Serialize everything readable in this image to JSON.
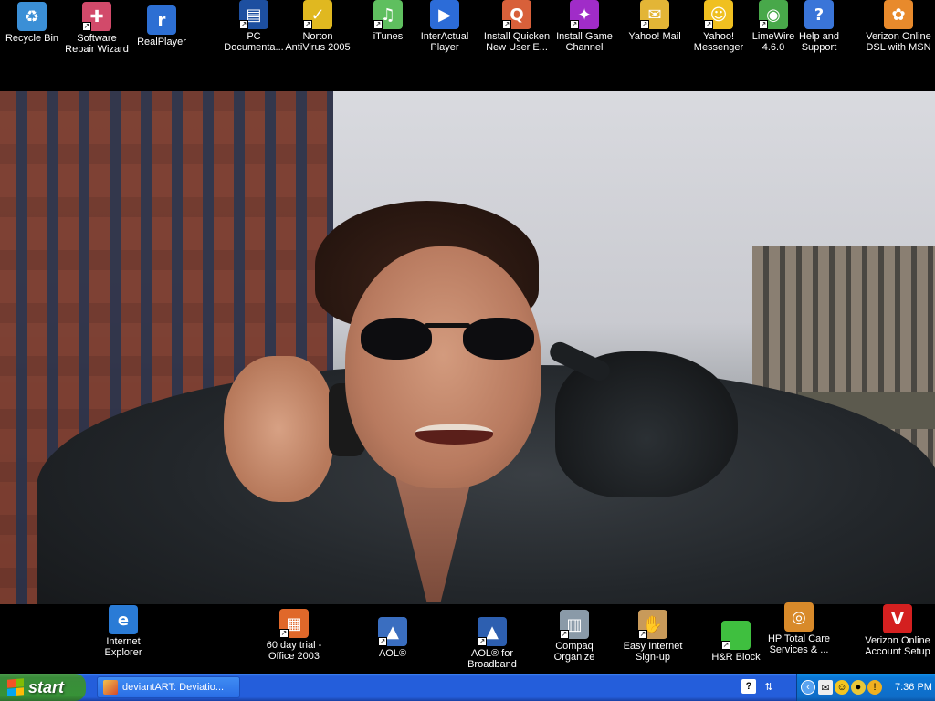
{
  "desktop": {
    "top_icons": [
      {
        "label": "Recycle Bin",
        "icon": "recycle-bin-icon",
        "color": "#3b8fd6",
        "glyph": "♻",
        "shortcut": false
      },
      {
        "label": "Software\nRepair Wizard",
        "icon": "repair-wizard-icon",
        "color": "#d24a6a",
        "glyph": "✚",
        "shortcut": true
      },
      {
        "label": "RealPlayer",
        "icon": "realplayer-icon",
        "color": "#2d6fd3",
        "glyph": "r",
        "shortcut": false
      },
      {
        "label": "PC\nDocumenta...",
        "icon": "pc-documentation-icon",
        "color": "#1d4fa0",
        "glyph": "▤",
        "shortcut": true
      },
      {
        "label": "Norton\nAntiVirus 2005",
        "icon": "norton-antivirus-icon",
        "color": "#e0b820",
        "glyph": "✓",
        "shortcut": true
      },
      {
        "label": "iTunes",
        "icon": "itunes-icon",
        "color": "#5fbf5f",
        "glyph": "♫",
        "shortcut": true
      },
      {
        "label": "InterActual\nPlayer",
        "icon": "interactual-player-icon",
        "color": "#2c6cd8",
        "glyph": "▶",
        "shortcut": false
      },
      {
        "label": "Install Quicken\nNew User E...",
        "icon": "quicken-icon",
        "color": "#d8603a",
        "glyph": "Q",
        "shortcut": true
      },
      {
        "label": "Install Game\nChannel",
        "icon": "game-channel-icon",
        "color": "#a02cc8",
        "glyph": "✦",
        "shortcut": true
      },
      {
        "label": "Yahoo! Mail",
        "icon": "yahoo-mail-icon",
        "color": "#e3b536",
        "glyph": "✉",
        "shortcut": true
      },
      {
        "label": "Yahoo!\nMessenger",
        "icon": "yahoo-messenger-icon",
        "color": "#f0c020",
        "glyph": "☺",
        "shortcut": true
      },
      {
        "label": "LimeWire\n4.6.0",
        "icon": "limewire-icon",
        "color": "#48a84a",
        "glyph": "◉",
        "shortcut": true
      },
      {
        "label": "Help and\nSupport",
        "icon": "help-support-icon",
        "color": "#3a75d8",
        "glyph": "?",
        "shortcut": false
      },
      {
        "label": "Verizon Online\nDSL with MSN",
        "icon": "msn-butterfly-icon",
        "color": "#e88a2c",
        "glyph": "✿",
        "shortcut": false
      }
    ],
    "bottom_icons": [
      {
        "label": "Internet\nExplorer",
        "icon": "internet-explorer-icon",
        "color": "#2a7bd6",
        "glyph": "e",
        "shortcut": false
      },
      {
        "label": "60 day trial -\nOffice 2003",
        "icon": "office-2003-icon",
        "color": "#e0682a",
        "glyph": "▦",
        "shortcut": true
      },
      {
        "label": "AOL®",
        "icon": "aol-icon",
        "color": "#3a6ec0",
        "glyph": "▲",
        "shortcut": true
      },
      {
        "label": "AOL® for\nBroadband",
        "icon": "aol-broadband-icon",
        "color": "#2d5fb0",
        "glyph": "▲",
        "shortcut": true
      },
      {
        "label": "Compaq\nOrganize",
        "icon": "compaq-organize-icon",
        "color": "#8a9aa8",
        "glyph": "▥",
        "shortcut": true
      },
      {
        "label": "Easy Internet\nSign-up",
        "icon": "easy-internet-signup-icon",
        "color": "#c89a5a",
        "glyph": "✋",
        "shortcut": true
      },
      {
        "label": "H&R Block",
        "icon": "hr-block-icon",
        "color": "#3fbf3f",
        "glyph": "",
        "shortcut": true
      },
      {
        "label": "HP Total Care\nServices & ...",
        "icon": "hp-total-care-icon",
        "color": "#d88a2a",
        "glyph": "◎",
        "shortcut": false
      },
      {
        "label": "Verizon Online\nAccount Setup",
        "icon": "verizon-setup-icon",
        "color": "#d42020",
        "glyph": "V",
        "shortcut": false
      }
    ]
  },
  "taskbar": {
    "start_label": "start",
    "tasks": [
      {
        "label": "deviantART: Deviatio..."
      }
    ],
    "clock": "7:36 PM",
    "colors": {
      "bar": "#245edb",
      "start": "#379237",
      "tray": "#0f6dc8"
    }
  }
}
